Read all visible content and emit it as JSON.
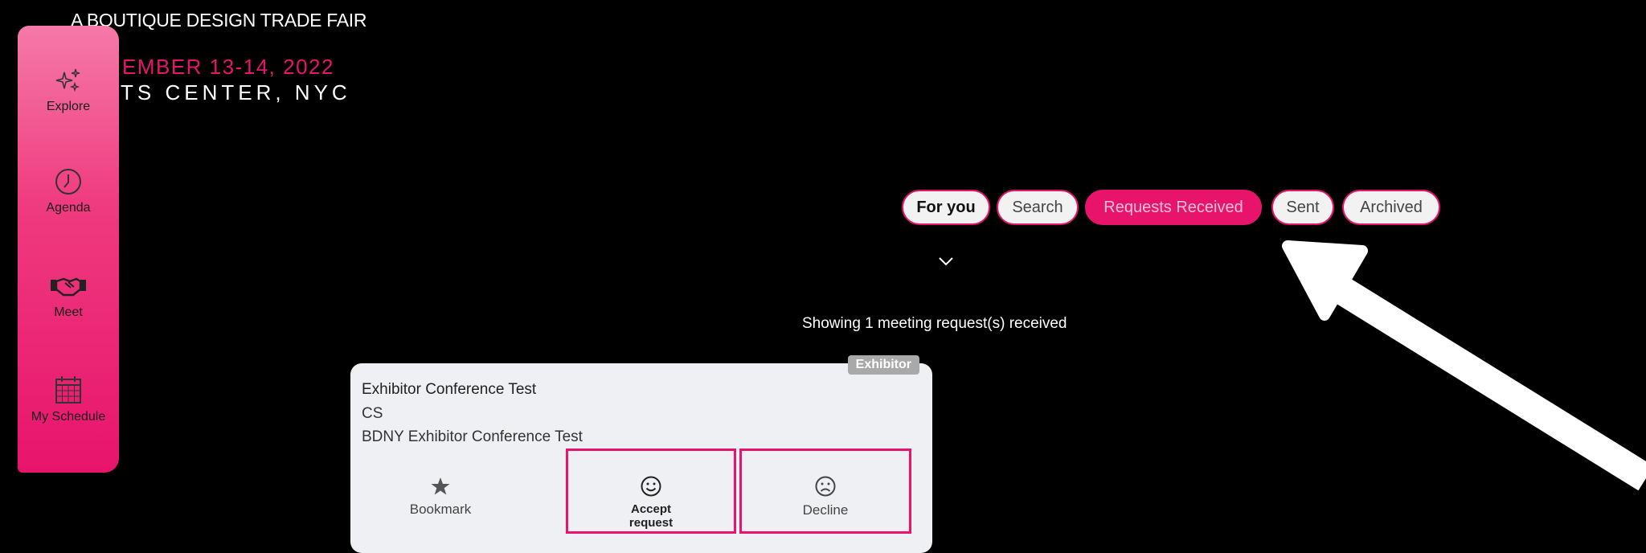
{
  "banner": {
    "tagline": "A BOUTIQUE DESIGN TRADE FAIR",
    "date": "EMBER 13-14, 2022",
    "venue": "TS CENTER, NYC"
  },
  "sidebar": {
    "items": [
      {
        "label": "Explore",
        "icon": "sparkles-icon"
      },
      {
        "label": "Agenda",
        "icon": "clock-icon"
      },
      {
        "label": "Meet",
        "icon": "handshake-icon"
      },
      {
        "label": "My Schedule",
        "icon": "calendar-icon"
      }
    ]
  },
  "tabs": [
    {
      "label": "For you"
    },
    {
      "label": "Search"
    },
    {
      "label": "Requests Received",
      "active": true
    },
    {
      "label": "Sent"
    },
    {
      "label": "Archived"
    }
  ],
  "status": {
    "showing": "Showing 1 meeting request(s) received"
  },
  "request_card": {
    "badge": "Exhibitor",
    "name": "Exhibitor Conference Test",
    "initials": "CS",
    "company": "BDNY Exhibitor Conference Test",
    "actions": {
      "bookmark": "Bookmark",
      "accept": "Accept request",
      "decline": "Decline"
    }
  },
  "colors": {
    "accent": "#e8146c",
    "background": "#000000",
    "card": "#eef0f3"
  }
}
